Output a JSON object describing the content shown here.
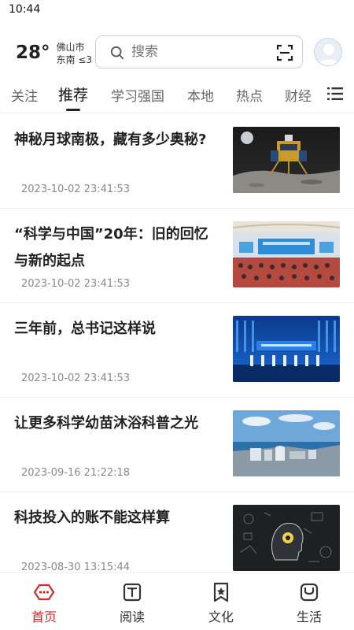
{
  "status_bar": {
    "time": "10:44"
  },
  "weather": {
    "temperature": "28°",
    "city": "佛山市",
    "wind": "东南 ≤3"
  },
  "search": {
    "placeholder": "搜索"
  },
  "tabs": [
    {
      "label": "关注",
      "active": false
    },
    {
      "label": "推荐",
      "active": true
    },
    {
      "label": "学习强国",
      "active": false
    },
    {
      "label": "本地",
      "active": false
    },
    {
      "label": "热点",
      "active": false
    },
    {
      "label": "财经",
      "active": false
    }
  ],
  "articles": [
    {
      "title": "神秘月球南极，藏有多少奥秘?",
      "date": "2023-10-02 23:41:53",
      "image": "lunar-lander-image"
    },
    {
      "title": "“科学与中国”20年：旧的回忆与新的起点",
      "date": "2023-10-02 23:41:53",
      "image": "conference-hall-image"
    },
    {
      "title": "三年前，总书记这样说",
      "date": "2023-10-02 23:41:53",
      "image": "stage-ceremony-image"
    },
    {
      "title": "让更多科学幼苗沐浴科普之光",
      "date": "2023-09-16 21:22:18",
      "image": "coastal-plant-image"
    },
    {
      "title": "科技投入的账不能这样算",
      "date": "2023-08-30 13:15:44",
      "image": "tech-head-image"
    }
  ],
  "bottom_nav": [
    {
      "label": "首页",
      "icon": "home-icon",
      "active": true
    },
    {
      "label": "阅读",
      "icon": "book-icon",
      "active": false
    },
    {
      "label": "文化",
      "icon": "culture-star-icon",
      "active": false
    },
    {
      "label": "生活",
      "icon": "life-icon",
      "active": false
    }
  ],
  "colors": {
    "accent": "#d32b2b",
    "text": "#222222",
    "muted": "#8a8a8a"
  }
}
